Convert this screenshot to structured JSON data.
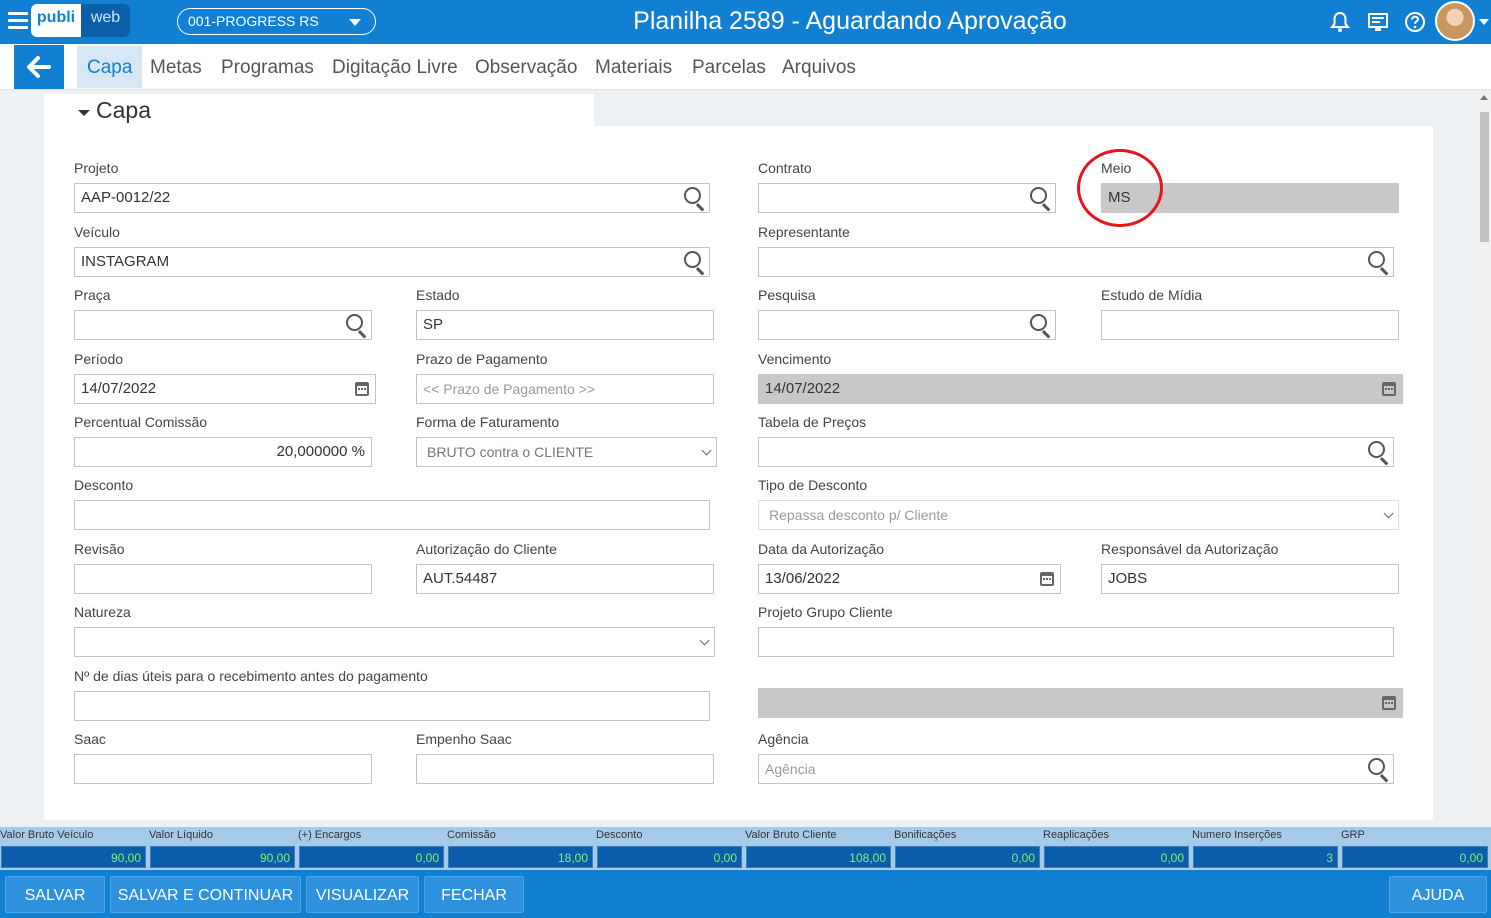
{
  "app": {
    "logo_part1": "publi",
    "logo_part2": "web",
    "unit_select": "001-PROGRESS RS",
    "title": "Planilha 2589 - Aguardando Aprovação"
  },
  "tabs": [
    "Capa",
    "Metas",
    "Programas",
    "Digitação Livre",
    "Observação",
    "Materiais",
    "Parcelas",
    "Arquivos"
  ],
  "section_title": "Capa",
  "fields": {
    "projeto": {
      "label": "Projeto",
      "value": "AAP-0012/22"
    },
    "contrato": {
      "label": "Contrato",
      "value": ""
    },
    "meio": {
      "label": "Meio",
      "value": "MS"
    },
    "veiculo": {
      "label": "Veículo",
      "value": "INSTAGRAM"
    },
    "representante": {
      "label": "Representante",
      "value": ""
    },
    "praca": {
      "label": "Praça",
      "value": ""
    },
    "estado": {
      "label": "Estado",
      "value": "SP"
    },
    "pesquisa": {
      "label": "Pesquisa",
      "value": ""
    },
    "estudo_midia": {
      "label": "Estudo de Mídia",
      "value": ""
    },
    "periodo": {
      "label": "Período",
      "value": "14/07/2022"
    },
    "prazo_pagamento": {
      "label": "Prazo de Pagamento",
      "placeholder": "<< Prazo de Pagamento >>"
    },
    "vencimento": {
      "label": "Vencimento",
      "value": "14/07/2022"
    },
    "percentual_comissao": {
      "label": "Percentual Comissão",
      "value": "20,000000 %"
    },
    "forma_faturamento": {
      "label": "Forma de Faturamento",
      "value": "BRUTO contra o CLIENTE"
    },
    "tabela_precos": {
      "label": "Tabela de Preços",
      "value": ""
    },
    "desconto": {
      "label": "Desconto",
      "value": ""
    },
    "tipo_desconto": {
      "label": "Tipo de Desconto",
      "value": "Repassa desconto p/ Cliente"
    },
    "revisao": {
      "label": "Revisão",
      "value": ""
    },
    "autorizacao_cliente": {
      "label": "Autorização do Cliente",
      "value": "AUT.54487"
    },
    "data_autorizacao": {
      "label": "Data da Autorização",
      "value": "13/06/2022"
    },
    "responsavel_autorizacao": {
      "label": "Responsável da Autorização",
      "value": "JOBS"
    },
    "natureza": {
      "label": "Natureza",
      "value": ""
    },
    "projeto_grupo_cliente": {
      "label": "Projeto Grupo Cliente",
      "value": ""
    },
    "dias_uteis": {
      "label": "Nº de dias úteis para o recebimento antes do pagamento",
      "value": ""
    },
    "saac": {
      "label": "Saac",
      "value": ""
    },
    "empenho_saac": {
      "label": "Empenho Saac",
      "value": ""
    },
    "agencia": {
      "label": "Agência",
      "placeholder": "Agência"
    }
  },
  "totals": [
    {
      "label": "Valor Bruto Veículo",
      "value": "90,00"
    },
    {
      "label": "Valor Líquido",
      "value": "90,00"
    },
    {
      "label": "(+) Encargos",
      "value": "0,00"
    },
    {
      "label": "Comissão",
      "value": "18,00"
    },
    {
      "label": "Desconto",
      "value": "0,00"
    },
    {
      "label": "Valor Bruto Cliente",
      "value": "108,00"
    },
    {
      "label": "Bonificações",
      "value": "0,00"
    },
    {
      "label": "Reaplicações",
      "value": "0,00"
    },
    {
      "label": "Numero Inserções",
      "value": "3"
    },
    {
      "label": "GRP",
      "value": "0,00"
    }
  ],
  "buttons": {
    "salvar": "SALVAR",
    "salvar_continuar": "SALVAR E CONTINUAR",
    "visualizar": "VISUALIZAR",
    "fechar": "FECHAR",
    "ajuda": "AJUDA"
  },
  "colors": {
    "primary": "#1280d2",
    "totals_bg": "#a6cbe8",
    "totals_value": "#7ef56f",
    "highlight_ring": "#e8141d"
  }
}
